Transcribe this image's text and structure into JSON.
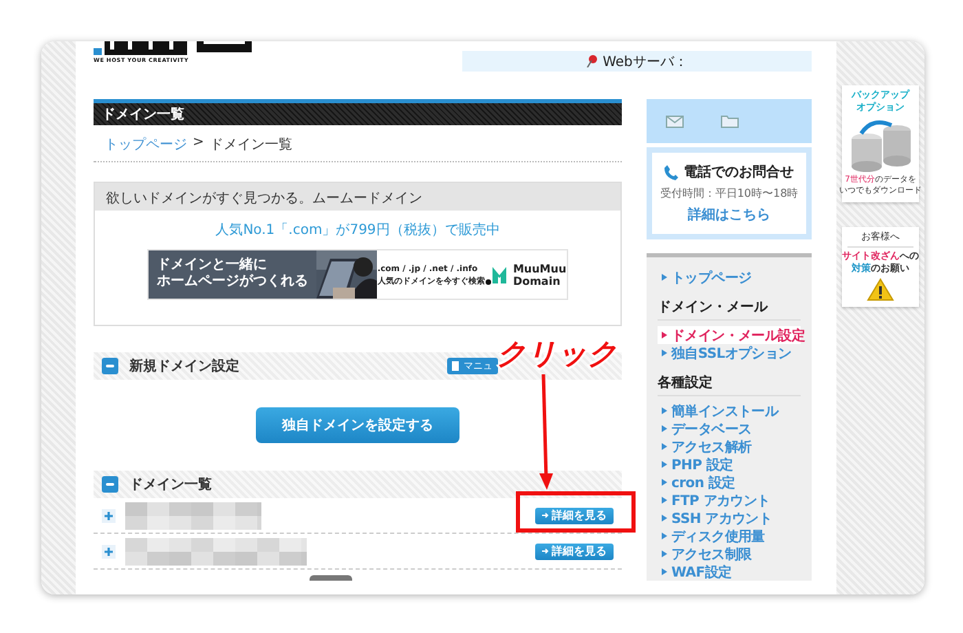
{
  "header": {
    "logo_tagline": "WE HOST YOUR CREATIVITY",
    "server_label": "Webサーバ："
  },
  "page_title": "ドメイン一覧",
  "breadcrumb": {
    "items": [
      "トップページ",
      "ドメイン一覧"
    ],
    "separator": ">"
  },
  "promo": {
    "heading": "欲しいドメインがすぐ見つかる。ムームードメイン",
    "link": "人気No.1「.com」が799円（税抜）で販売中",
    "banner": {
      "caption_lines": [
        "ドメインと一緒に",
        "ホームページがつくれる"
      ],
      "tlds": ".com / .jp / .net / .info",
      "tagline": "人気のドメインを今すぐ検索",
      "brand_lines": [
        "MuuMuu",
        "Domain"
      ]
    }
  },
  "new_domain": {
    "title": "新規ドメイン設定",
    "manual_button": "マニュ",
    "primary_button": "独自ドメインを設定する"
  },
  "domain_list": {
    "title": "ドメイン一覧",
    "rows": [
      {
        "button": "詳細を見る"
      },
      {
        "button": "詳細を見る"
      }
    ]
  },
  "contact": {
    "title": "電話でのお問合せ",
    "hours": "受付時間：平日10時〜18時",
    "link": "詳細はこちら"
  },
  "nav": [
    {
      "kind": "link",
      "label": "トップページ",
      "selected": false
    },
    {
      "kind": "heading",
      "label": "ドメイン・メール"
    },
    {
      "kind": "link",
      "label": "ドメイン・メール設定",
      "selected": true
    },
    {
      "kind": "link",
      "label": "独自SSLオプション",
      "selected": false
    },
    {
      "kind": "heading",
      "label": "各種設定"
    },
    {
      "kind": "link",
      "label": "簡単インストール",
      "selected": false
    },
    {
      "kind": "link",
      "label": "データベース",
      "selected": false
    },
    {
      "kind": "link",
      "label": "アクセス解析",
      "selected": false
    },
    {
      "kind": "link",
      "label": "PHP 設定",
      "selected": false
    },
    {
      "kind": "link",
      "label": "cron 設定",
      "selected": false
    },
    {
      "kind": "link",
      "label": "FTP アカウント",
      "selected": false
    },
    {
      "kind": "link",
      "label": "SSH アカウント",
      "selected": false
    },
    {
      "kind": "link",
      "label": "ディスク使用量",
      "selected": false
    },
    {
      "kind": "link",
      "label": "アクセス制限",
      "selected": false
    },
    {
      "kind": "link",
      "label": "WAF設定",
      "selected": false
    }
  ],
  "ads": [
    {
      "kind": "backup",
      "title_lines": [
        "バックアップ",
        "オプション"
      ],
      "note_lines": [
        [
          {
            "text": "7世代分",
            "color": "#e0245e"
          },
          {
            "text": "のデータを",
            "color": "#333333"
          }
        ],
        [
          {
            "text": "いつでもダウンロード",
            "color": "#333333"
          }
        ]
      ]
    },
    {
      "kind": "notice",
      "title_lines": [
        "お客様へ"
      ],
      "note_lines": [
        [
          {
            "text": "サイト改ざん",
            "color": "#e0245e"
          },
          {
            "text": "への",
            "color": "#333333"
          }
        ],
        [
          {
            "text": "対策",
            "color": "#1e96c8"
          },
          {
            "text": "のお願い",
            "color": "#333333"
          }
        ]
      ]
    }
  ],
  "annotation": {
    "text": "クリック"
  }
}
